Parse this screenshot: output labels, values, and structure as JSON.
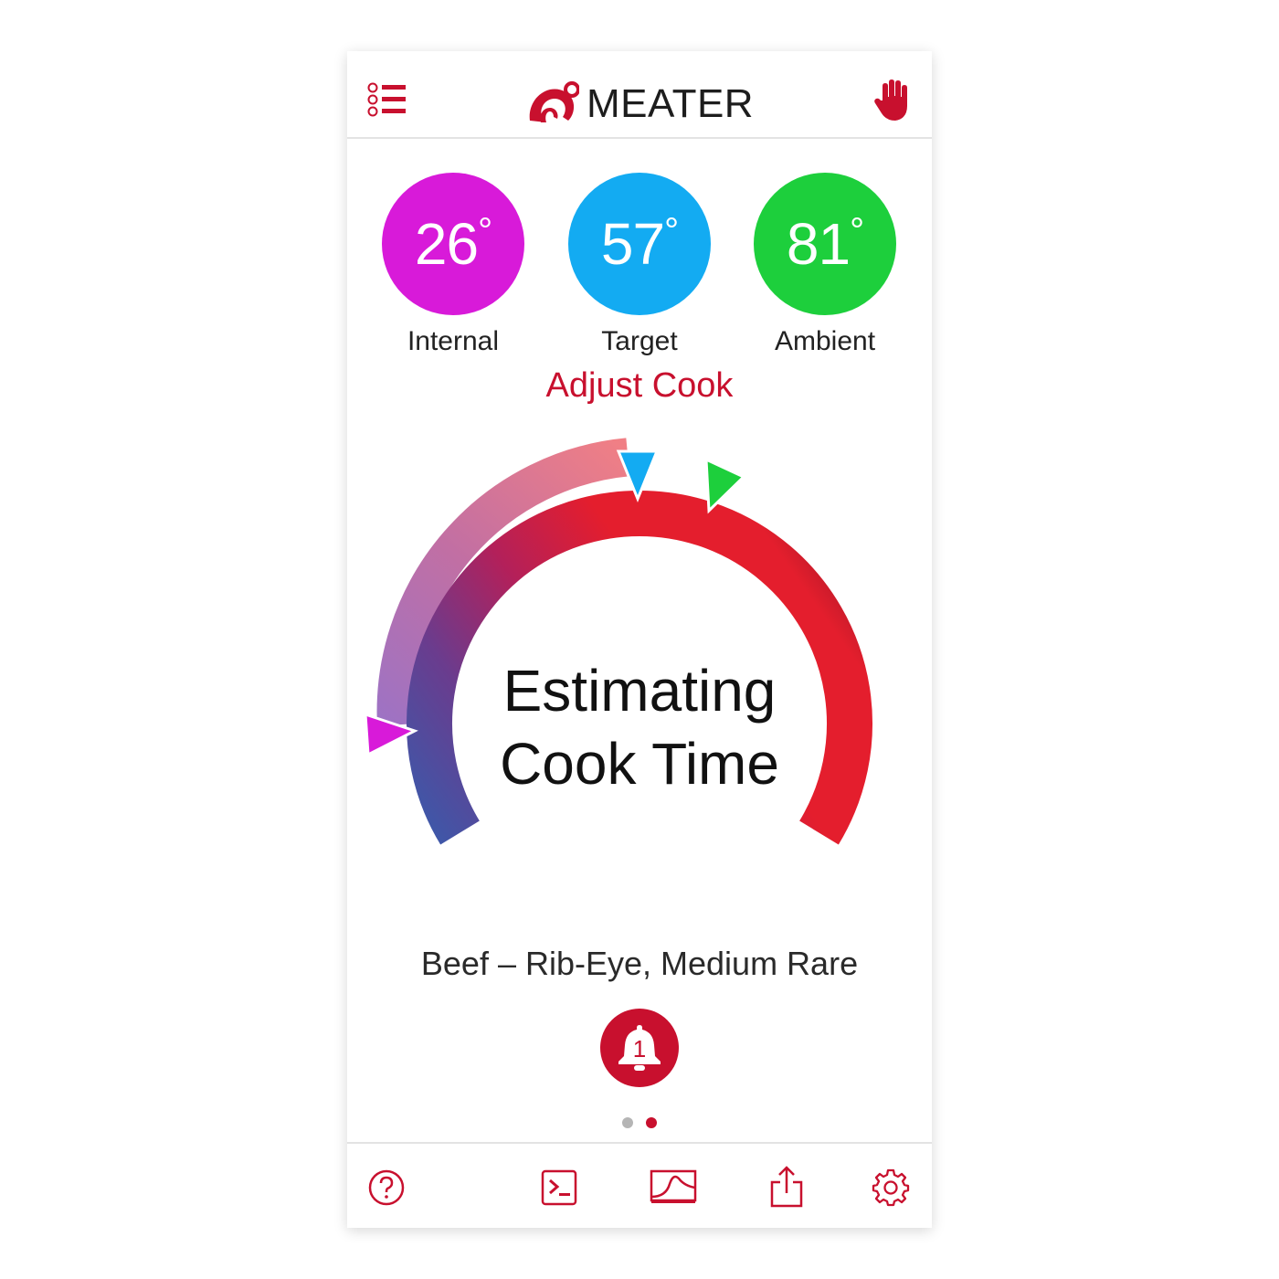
{
  "app": {
    "title": "MEATER"
  },
  "colors": {
    "brand": "#c8102e",
    "internal": "#d81ad9",
    "target": "#13abf2",
    "ambient": "#1dcf3c"
  },
  "header": {
    "menu_icon": "menu-list-icon",
    "logo_icon": "meater-flame-logo-icon",
    "stop_icon": "stop-hand-icon"
  },
  "temperatures": [
    {
      "label": "Internal",
      "value": "26",
      "unit": "°"
    },
    {
      "label": "Target",
      "value": "57",
      "unit": "°"
    },
    {
      "label": "Ambient",
      "value": "81",
      "unit": "°"
    }
  ],
  "adjust_cook_label": "Adjust Cook",
  "cook_status": {
    "line1": "Estimating",
    "line2": "Cook Time"
  },
  "cut_description": "Beef – Rib-Eye, Medium Rare",
  "alerts": {
    "icon": "bell-icon",
    "count": "1"
  },
  "pager": {
    "total": 2,
    "active": 2
  },
  "tabbar": [
    {
      "icon": "help-icon",
      "name": "help"
    },
    {
      "icon": "terminal-icon",
      "name": "log"
    },
    {
      "icon": "graph-icon",
      "name": "graph"
    },
    {
      "icon": "share-icon",
      "name": "share"
    },
    {
      "icon": "gear-icon",
      "name": "settings"
    }
  ]
}
